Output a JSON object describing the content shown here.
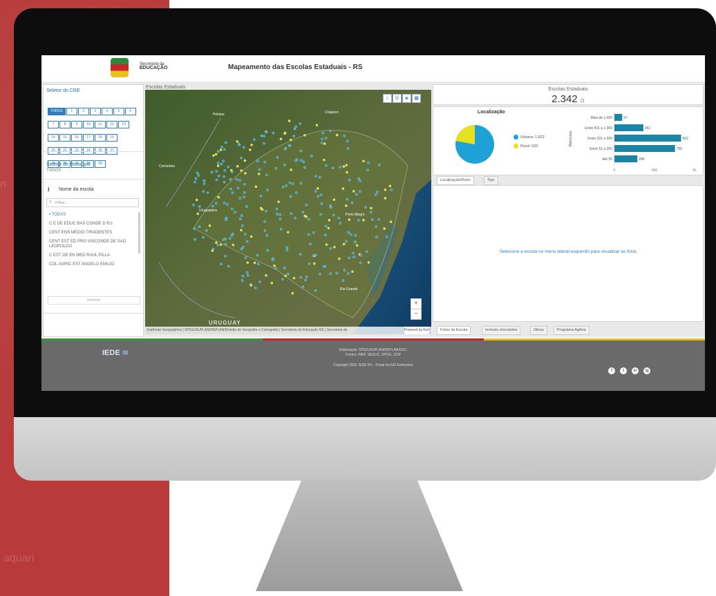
{
  "background": {
    "text1": "n",
    "text2": "aquari",
    "color": "#b83a3a"
  },
  "header": {
    "secretaria_line1": "Secretaria da",
    "secretaria_line2": "EDUCAÇÃO",
    "title": "Mapeamento das Escolas Estaduais - RS"
  },
  "sidebar": {
    "cre_title": "Seletor do CRE",
    "cre_buttons": [
      "TODOS",
      "1",
      "2",
      "3",
      "4",
      "5",
      "6",
      "7",
      "8",
      "9",
      "10",
      "11",
      "12",
      "13",
      "14",
      "15",
      "16",
      "17",
      "18",
      "19",
      "20",
      "21",
      "23",
      "24",
      "25",
      "27",
      "28",
      "32",
      "35",
      "36",
      "39"
    ],
    "municipio_title": "Seletor do Município",
    "municipio_value": "TODOS",
    "escola_title": "Nome da escola",
    "filter_placeholder": "Filtrar...",
    "schools": [
      "TODAS",
      "C E DE EDUC BAS CONDE D EU",
      "CENT ENS MEDIO TIRADENTES",
      "CENT EST ED PRO VISCONDE DE SAO LEOPOLDO",
      "C EST DE EN MED RAUL PILLA",
      "COL AGRIC EST ANGELO EMILIO"
    ],
    "reset_label": "Redefinir"
  },
  "map": {
    "title": "Escolas Estaduais",
    "labels": {
      "uruguay": "URUGUAY",
      "pelotas": "Pelotas",
      "chapeco": "Chapecó",
      "corrientes": "Corrientes",
      "rio_grande": "Rio Grande",
      "porto_alegre": "Porto Alegre",
      "uruguaiana": "Uruguaiana"
    },
    "attribution": "Earthstar Geographics | SPGG/SUPLAN/DEPLAN/Divisão de Geografia e Cartografia | Secretaria de Educação RS | Secretaria da",
    "powered": "Powered by Esri",
    "zoom_in": "+",
    "zoom_out": "−",
    "colors": {
      "urbana": "#1ea1d6",
      "rural": "#e6e021"
    }
  },
  "stats": {
    "label": "Escolas Estaduais",
    "value": "2.342"
  },
  "localizacao": {
    "title": "Localização",
    "legend": [
      {
        "label": "Urbana: 1.822",
        "color": "#1ea1d6"
      },
      {
        "label": "Rural: 520",
        "color": "#e6e021"
      }
    ]
  },
  "chart_data": {
    "type": "bar",
    "categories": [
      "Mais de 1.000",
      "Entre 501 a 1.000",
      "Entre 201 a 500",
      "Entre 51 a 200",
      "Até 50"
    ],
    "values": [
      97,
      361,
      832,
      756,
      286
    ],
    "ylabel": "Matrículas",
    "xticks": [
      "0",
      "500",
      "1k"
    ],
    "xlim": [
      0,
      1000
    ],
    "color": "#1b85a8"
  },
  "tabs_top": [
    "Localização/Porte",
    "Tipo"
  ],
  "photos_message": "Selecione a escola no menu lateral esquerdo para visualizar as fotos",
  "tabs_bottom": [
    "Fotos da Escola",
    "Imóveis vinculados",
    "Obras",
    "Programa Agiliza"
  ],
  "footer": {
    "logo": "IEDE",
    "line1": "Elaboração: SPGG/SUPLAN/DEPLAN/DGC",
    "line2": "Fontes: INEP, SEDUC, SPGG, SOP",
    "copyright": "Copyright 2020. IEDE RS - Portal ArcGIS Enterprise",
    "social": [
      "f",
      "t",
      "in",
      "ig"
    ]
  }
}
